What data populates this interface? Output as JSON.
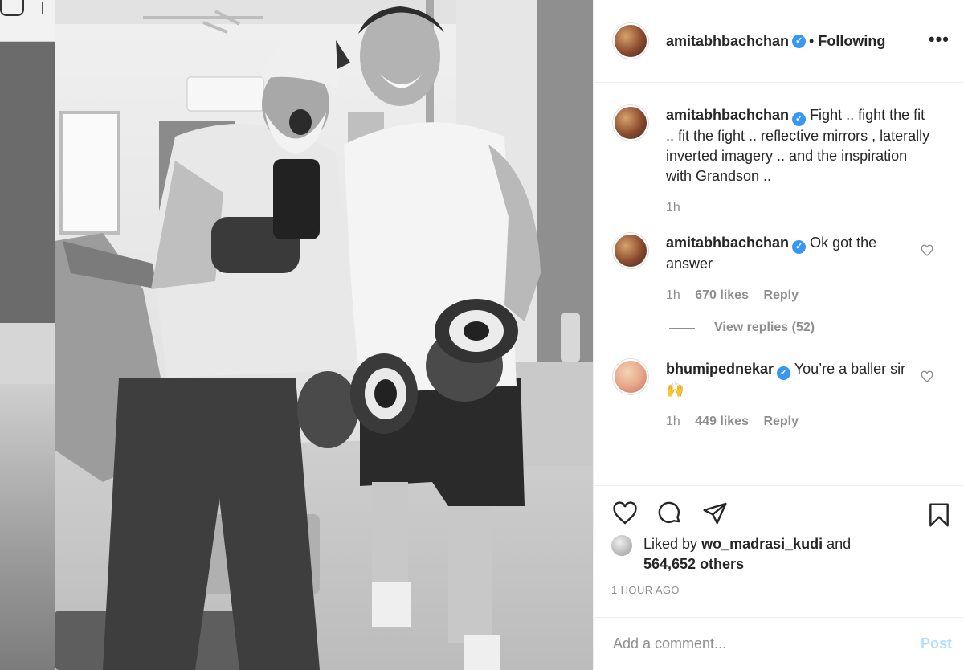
{
  "post": {
    "author": "amitabhbachchan",
    "follow_status": "Following",
    "more_label": "•••",
    "verified_mark": "✓"
  },
  "caption": {
    "username": "amitabhbachchan",
    "text": "Fight .. fight the fit .. fit the fight .. reflective mirrors , laterally inverted imagery .. and the inspiration with Grandson ..",
    "time": "1h"
  },
  "comments": [
    {
      "username": "amitabhbachchan",
      "text": "Ok got the answer",
      "time": "1h",
      "likes": "670 likes",
      "reply": "Reply",
      "view_replies": "View replies (52)"
    },
    {
      "username": "bhumipednekar",
      "text": "You’re a baller sir 🙌",
      "time": "1h",
      "likes": "449 likes",
      "reply": "Reply"
    }
  ],
  "likes": {
    "liked_by_prefix": "Liked by",
    "liked_by_user": "wo_madrasi_kudi",
    "and": "and",
    "others": "564,652 others"
  },
  "timestamp": "1 HOUR AGO",
  "add_comment": {
    "placeholder": "Add a comment...",
    "post_label": "Post"
  },
  "icons": [
    "heart-icon",
    "comment-icon",
    "share-icon",
    "bookmark-icon",
    "more-icon"
  ]
}
